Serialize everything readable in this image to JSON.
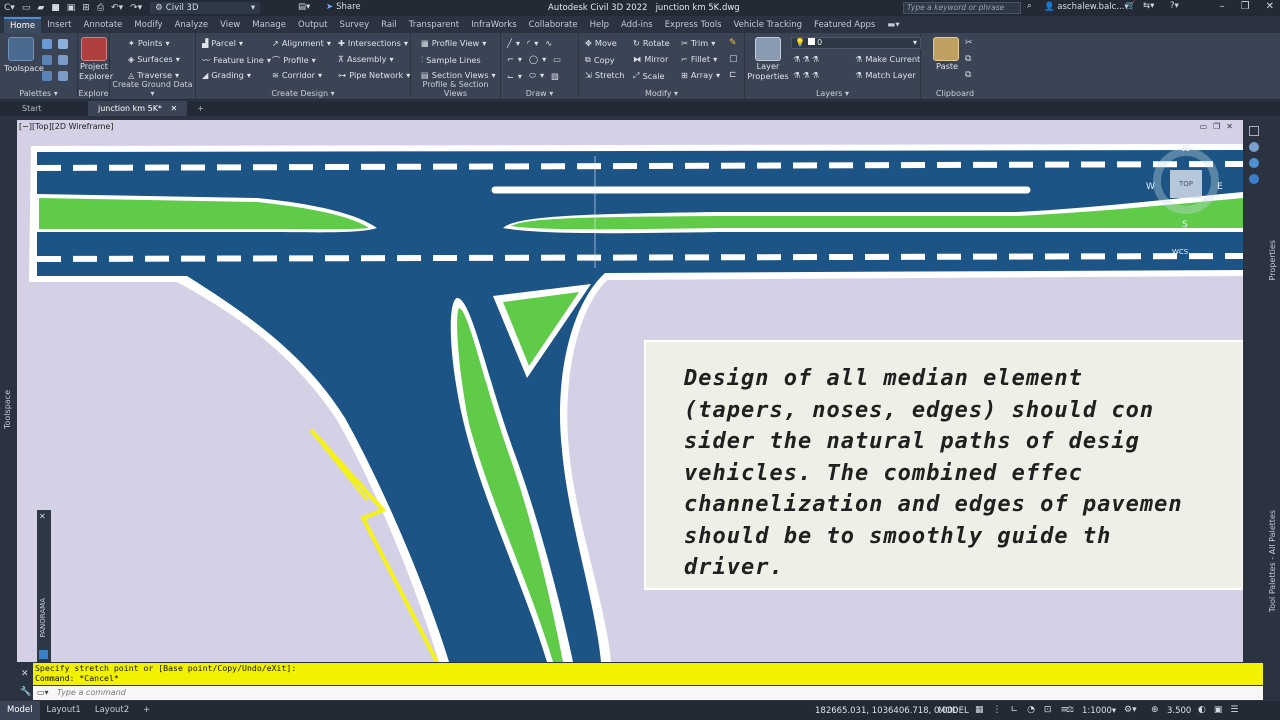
{
  "title_bar": {
    "app_title": "Autodesk Civil 3D 2022",
    "file_title": "junction km 5K.dwg",
    "workspace": "Civil 3D",
    "share_label": "Share",
    "search_placeholder": "Type a keyword or phrase",
    "user": "aschalew.balc..."
  },
  "ribbon_tabs": [
    "Home",
    "Insert",
    "Annotate",
    "Modify",
    "Analyze",
    "View",
    "Manage",
    "Output",
    "Survey",
    "Rail",
    "Transparent",
    "InfraWorks",
    "Collaborate",
    "Help",
    "Add-ins",
    "Express Tools",
    "Vehicle Tracking",
    "Featured Apps"
  ],
  "ribbon": {
    "palettes": {
      "toolspace": "Toolspace",
      "label": "Palettes"
    },
    "explore": {
      "project_explorer": "Project Explorer",
      "label": "Explore"
    },
    "ground": {
      "points": "Points",
      "surfaces": "Surfaces",
      "traverse": "Traverse",
      "label": "Create Ground Data"
    },
    "design": {
      "parcel": "Parcel",
      "feature_line": "Feature Line",
      "grading": "Grading",
      "alignment": "Alignment",
      "profile": "Profile",
      "corridor": "Corridor",
      "intersections": "Intersections",
      "assembly": "Assembly",
      "pipe_network": "Pipe Network",
      "label": "Create Design"
    },
    "pview": {
      "profile_view": "Profile View",
      "sample_lines": "Sample Lines",
      "section_views": "Section Views",
      "label": "Profile & Section Views"
    },
    "draw": {
      "label": "Draw"
    },
    "modify": {
      "move": "Move",
      "copy": "Copy",
      "stretch": "Stretch",
      "rotate": "Rotate",
      "mirror": "Mirror",
      "scale": "Scale",
      "trim": "Trim",
      "fillet": "Fillet",
      "array": "Array",
      "label": "Modify"
    },
    "layers": {
      "layer_properties": "Layer Properties",
      "current_layer": "0",
      "make_current": "Make Current",
      "match_layer": "Match Layer",
      "label": "Layers"
    },
    "clipboard": {
      "paste": "Paste",
      "label": "Clipboard"
    }
  },
  "file_tabs": {
    "start": "Start",
    "active": "junction km 5K*"
  },
  "viewport": {
    "label": "[−][Top][2D Wireframe]",
    "viewcube": {
      "n": "N",
      "w": "W",
      "e": "E",
      "s": "S",
      "top": "TOP",
      "wcs": "WCS"
    }
  },
  "note_text": [
    "Design  of  all  median  element",
    "(tapers,  noses,  edges)  should  con",
    "sider  the  natural  paths  of  desig",
    "vehicles.    The  combined  effec",
    "channelization  and  edges  of  pavemen",
    "should  be  to  smoothly  guide  th",
    "driver."
  ],
  "side_labels": {
    "toolspace": "Toolspace",
    "panorama": "PANORAMA",
    "properties": "Properties",
    "tool_palettes": "Tool Palettes - All Palettes"
  },
  "command": {
    "history": [
      "Specify stretch point or [Base point/Copy/Undo/eXit]:",
      "Command: *Cancel*"
    ],
    "placeholder": "Type a command"
  },
  "layout_tabs": [
    "Model",
    "Layout1",
    "Layout2"
  ],
  "status": {
    "coords": "182665.031, 1036406.718, 0.000",
    "model": "MODEL",
    "scale": "1:1000",
    "zoom": "3.500"
  },
  "colors": {
    "road": "#1c5585",
    "island": "#5fcb48",
    "bg": "#d4d1e6",
    "command_bar": "#f2f200",
    "marker": "#f5f21a"
  }
}
